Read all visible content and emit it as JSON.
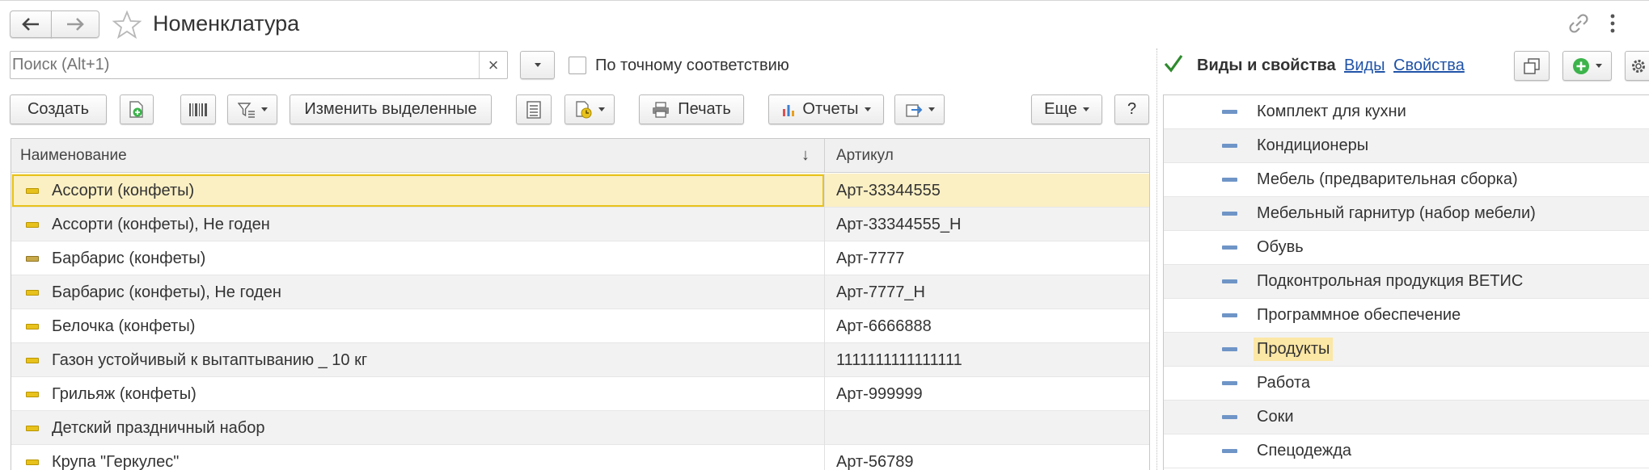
{
  "window": {
    "title": "Номенклатура"
  },
  "search": {
    "placeholder": "Поиск (Alt+1)",
    "value": "",
    "clear_symbol": "×",
    "exact_match_label": "По точному соответствию",
    "exact_match_checked": false
  },
  "toolbar": {
    "create_label": "Создать",
    "change_selected_label": "Изменить выделенные",
    "print_label": "Печать",
    "reports_label": "Отчеты",
    "more_label": "Еще",
    "help_label": "?"
  },
  "grid": {
    "columns": [
      "Наименование",
      "Артикул"
    ],
    "sort_indicator": "↓",
    "rows": [
      {
        "name": "Ассорти (конфеты)",
        "article": "Арт-33344555",
        "icon": "yellow"
      },
      {
        "name": "Ассорти (конфеты), Не годен",
        "article": "Арт-33344555_Н",
        "icon": "yellow"
      },
      {
        "name": "Барбарис (конфеты)",
        "article": "Арт-7777",
        "icon": "brown"
      },
      {
        "name": "Барбарис (конфеты), Не годен",
        "article": "Арт-7777_Н",
        "icon": "yellow"
      },
      {
        "name": "Белочка (конфеты)",
        "article": "Арт-6666888",
        "icon": "yellow"
      },
      {
        "name": "Газон устойчивый к вытаптыванию _ 10 кг",
        "article": "1111111111111111",
        "icon": "yellow"
      },
      {
        "name": "Грильяж (конфеты)",
        "article": "Арт-999999",
        "icon": "yellow"
      },
      {
        "name": "Детский праздничный набор",
        "article": "",
        "icon": "yellow"
      },
      {
        "name": "Крупа \"Геркулес\"",
        "article": "Арт-56789",
        "icon": "yellow"
      }
    ]
  },
  "panel": {
    "checkbox_checked": true,
    "title": "Виды и свойства",
    "link_kinds": "Виды",
    "link_properties": "Свойства",
    "items": [
      "Комплект для кухни",
      "Кондиционеры",
      "Мебель (предварительная сборка)",
      "Мебельный гарнитур (набор мебели)",
      "Обувь",
      "Подконтрольная продукция ВЕТИС",
      "Программное обеспечение",
      "Продукты",
      "Работа",
      "Соки",
      "Спецодежда"
    ],
    "active_item": "Продукты"
  },
  "colors": {
    "selection_row": "#fbf0c4",
    "selection_border": "#e8c21c",
    "link": "#2053a8",
    "add_button_green": "#3cb44b",
    "check_green": "#2e8b2e"
  },
  "icons": [
    "back-arrow-icon",
    "forward-arrow-icon",
    "star-icon",
    "link-icon",
    "more-vertical-icon",
    "clear-icon",
    "dropdown-icon",
    "copy-icon",
    "barcode-icon",
    "filter-icon",
    "list-icon",
    "documents-icon",
    "printer-icon",
    "chart-icon",
    "export-icon",
    "windows-icon",
    "add-icon",
    "settings-icon",
    "sort-down-icon"
  ]
}
